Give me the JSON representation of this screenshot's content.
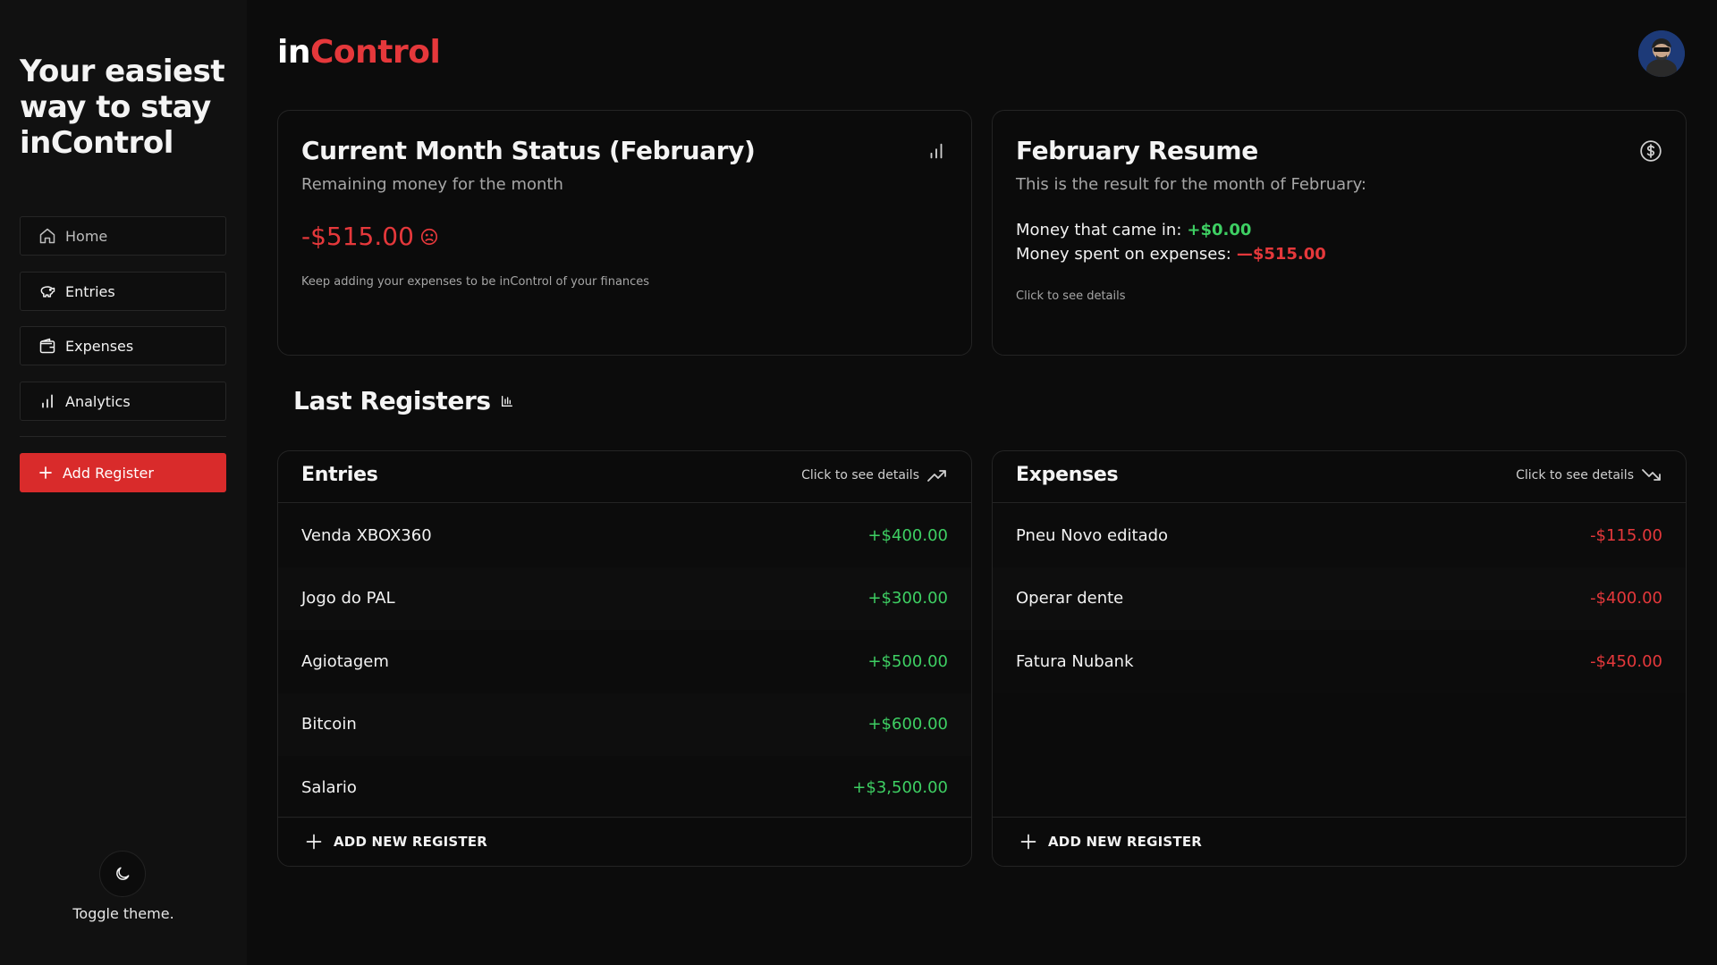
{
  "sidebar": {
    "tagline": "Your easiest way to stay inControl",
    "nav": [
      {
        "label": "Home",
        "icon": "home-icon"
      },
      {
        "label": "Entries",
        "icon": "piggy-bank-icon"
      },
      {
        "label": "Expenses",
        "icon": "wallet-icon"
      },
      {
        "label": "Analytics",
        "icon": "bar-chart-icon"
      }
    ],
    "add_register_label": "Add Register",
    "theme_label": "Toggle theme."
  },
  "header": {
    "brand_in": "in",
    "brand_control": "Control"
  },
  "status_card": {
    "title": "Current Month Status (February)",
    "subtitle": "Remaining money for the month",
    "remaining": "-$515.00",
    "hint": "Keep adding your expenses to be inControl of your finances"
  },
  "resume_card": {
    "title": "February Resume",
    "subtitle": "This is the result for the month of February:",
    "came_in_label": "Money that came in:",
    "came_in_value": "+$0.00",
    "spent_label": "Money spent on expenses:",
    "spent_value": "—$515.00",
    "hint": "Click to see details"
  },
  "section": {
    "title": "Last Registers"
  },
  "entries": {
    "title": "Entries",
    "link": "Click to see details",
    "rows": [
      {
        "name": "Venda XBOX360",
        "amount": "+$400.00"
      },
      {
        "name": "Jogo do PAL",
        "amount": "+$300.00"
      },
      {
        "name": "Agiotagem",
        "amount": "+$500.00"
      },
      {
        "name": "Bitcoin",
        "amount": "+$600.00"
      },
      {
        "name": "Salario",
        "amount": "+$3,500.00"
      }
    ],
    "add_label": "ADD NEW REGISTER"
  },
  "expenses": {
    "title": "Expenses",
    "link": "Click to see details",
    "rows": [
      {
        "name": "Pneu Novo editado",
        "amount": "-$115.00"
      },
      {
        "name": "Operar dente",
        "amount": "-$400.00"
      },
      {
        "name": "Fatura Nubank",
        "amount": "-$450.00"
      }
    ],
    "add_label": "ADD NEW REGISTER"
  },
  "colors": {
    "accent_red": "#e5383b",
    "positive_green": "#3ecf63",
    "background": "#0c0c0c"
  }
}
